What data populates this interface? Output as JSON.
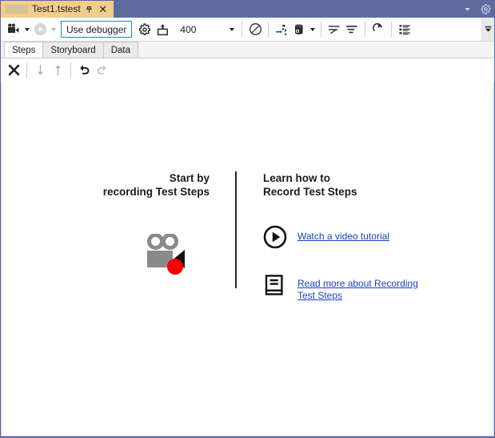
{
  "window": {
    "chrome_color": "#5d6b9e",
    "document_tab": {
      "title": "Test1.tstest",
      "pin_icon": "pin-icon",
      "close_icon": "close-icon",
      "redacted": ""
    },
    "title_controls": [
      {
        "name": "window-dropdown",
        "icon": "chevron-down-icon"
      },
      {
        "name": "window-settings",
        "icon": "gear-icon"
      }
    ]
  },
  "toolbar": {
    "record_button": {
      "label": "",
      "icon": "video-camera-icon",
      "tooltip": ""
    },
    "record_dropdown_icon": "caret-down-icon",
    "play_button": {
      "icon": "play-circle-icon",
      "enabled": false
    },
    "play_dropdown_icon": "caret-down-icon",
    "debugger_combo": {
      "value": "Use debugger",
      "placeholder": "Use debugger"
    },
    "settings_button": {
      "icon": "gear-icon"
    },
    "upload_button": {
      "icon": "upload-box-icon"
    },
    "iterations_combo": {
      "value": "400",
      "dropdown_icon": "caret-down-icon"
    },
    "timer_button": {
      "icon": "clock-slash-icon"
    },
    "branch_button": {
      "icon": "branch-arrow-icon"
    },
    "data_button": {
      "icon": "database-icon"
    },
    "data_dropdown_icon": "caret-down-icon",
    "indent_button": {
      "icon": "edit-lines-icon"
    },
    "filter_button": {
      "icon": "filter-lines-icon"
    },
    "refresh_button": {
      "icon": "refresh-icon"
    },
    "list_button": {
      "icon": "list-details-icon"
    },
    "overflow_button": {
      "icon": "chevron-double-down-icon"
    }
  },
  "tabs": [
    {
      "label": "Steps",
      "active": true
    },
    {
      "label": "Storyboard",
      "active": false
    },
    {
      "label": "Data",
      "active": false
    }
  ],
  "editor_toolbar": {
    "delete_button": {
      "icon": "x-delete-icon",
      "enabled": true
    },
    "move_down_button": {
      "icon": "arrow-down-icon",
      "enabled": false
    },
    "move_up_button": {
      "icon": "arrow-up-icon",
      "enabled": false
    },
    "undo_button": {
      "icon": "undo-icon",
      "enabled": true
    },
    "redo_button": {
      "icon": "redo-icon",
      "enabled": false
    }
  },
  "content": {
    "left_panel": {
      "heading_line1": "Start by",
      "heading_line2": "recording Test Steps",
      "illustration_icon": "video-camera-record-icon"
    },
    "right_panel": {
      "heading_line1": "Learn how to",
      "heading_line2": "Record Test Steps",
      "links": [
        {
          "icon": "play-circle-icon",
          "text": "Watch a video tutorial",
          "color": "#1a3fbf"
        },
        {
          "icon": "book-icon",
          "text": "Read more about Recording Test Steps",
          "color": "#1a3fbf"
        }
      ]
    }
  }
}
